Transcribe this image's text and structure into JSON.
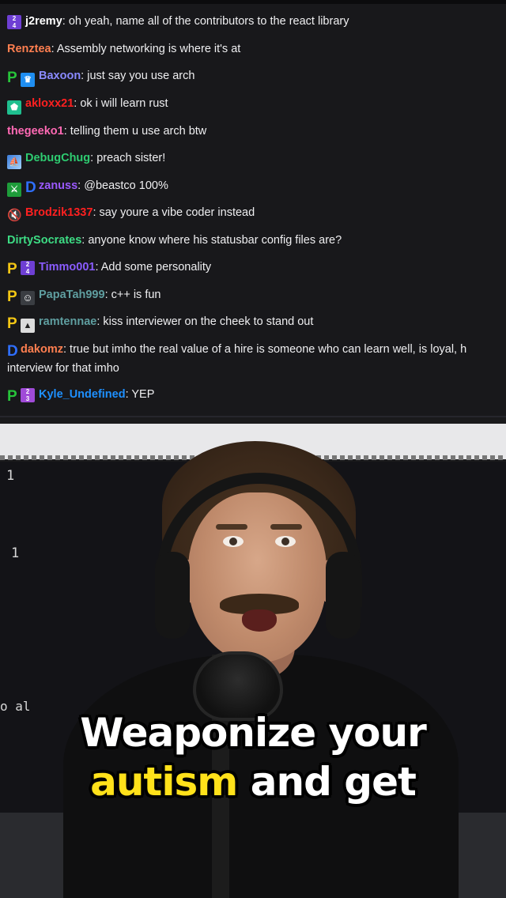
{
  "chat": {
    "messages": [
      {
        "badges": [
          "2024-badge"
        ],
        "user": "j2remy",
        "color": "#ffffff",
        "text": ": oh yeah, name all of the contributors to the react library"
      },
      {
        "badges": [],
        "user": "Renztea",
        "color": "#ff7f50",
        "text": ": Assembly networking is where it's at"
      },
      {
        "badges": [
          "prediction-green-icon",
          "crown-badge"
        ],
        "user": "Baxoon",
        "color": "#8a8aff",
        "text": ": just say you use arch"
      },
      {
        "badges": [
          "gem-badge"
        ],
        "user": "akloxx21",
        "color": "#ff2020",
        "text": ": ok i will learn rust"
      },
      {
        "badges": [],
        "user": "thegeeko1",
        "color": "#ff69b4",
        "text": ": telling them u use arch btw"
      },
      {
        "badges": [
          "art-badge"
        ],
        "user": "DebugChug",
        "color": "#2ecc71",
        "text": ": preach sister!"
      },
      {
        "badges": [
          "sword-badge",
          "prediction-blue-icon"
        ],
        "user": "zanuss",
        "color": "#9b59ff",
        "text": ": @beastco 100%"
      },
      {
        "badges": [
          "mute-badge"
        ],
        "user": "Brodzik1337",
        "color": "#ff2020",
        "text": ": say youre a vibe coder instead"
      },
      {
        "badges": [],
        "user": "DirtySocrates",
        "color": "#3ddc84",
        "text": ": anyone know where his statusbar config files are?"
      },
      {
        "badges": [
          "prediction-yellow-icon",
          "2024-badge"
        ],
        "user": "Timmo001",
        "color": "#8a5cff",
        "text": ": Add some personality"
      },
      {
        "badges": [
          "prediction-yellow-icon",
          "bot-badge"
        ],
        "user": "PapaTah999",
        "color": "#5f9ea0",
        "text": ": c++ is fun"
      },
      {
        "badges": [
          "prediction-yellow-icon",
          "triangle-badge"
        ],
        "user": "ramtennae",
        "color": "#5f9ea0",
        "text": ": kiss interviewer on the cheek to stand out"
      },
      {
        "badges": [
          "prediction-blue-icon"
        ],
        "user": "dakomz",
        "color": "#ff7f50",
        "text": ": true but imho the real value of a hire is someone who can learn well, is loyal, h",
        "continuation": "interview for that imho"
      },
      {
        "badges": [
          "prediction-green-icon",
          "2023-badge"
        ],
        "user": "Kyle_Undefined",
        "color": "#1e90ff",
        "text": ": YEP"
      }
    ]
  },
  "video": {
    "line_numbers": [
      "1",
      "1",
      "o al"
    ],
    "caption_line1": "Weaponize your",
    "caption_line2_highlight": "autism",
    "caption_line2_rest": " and get",
    "highlight_color": "#ffe11a"
  }
}
